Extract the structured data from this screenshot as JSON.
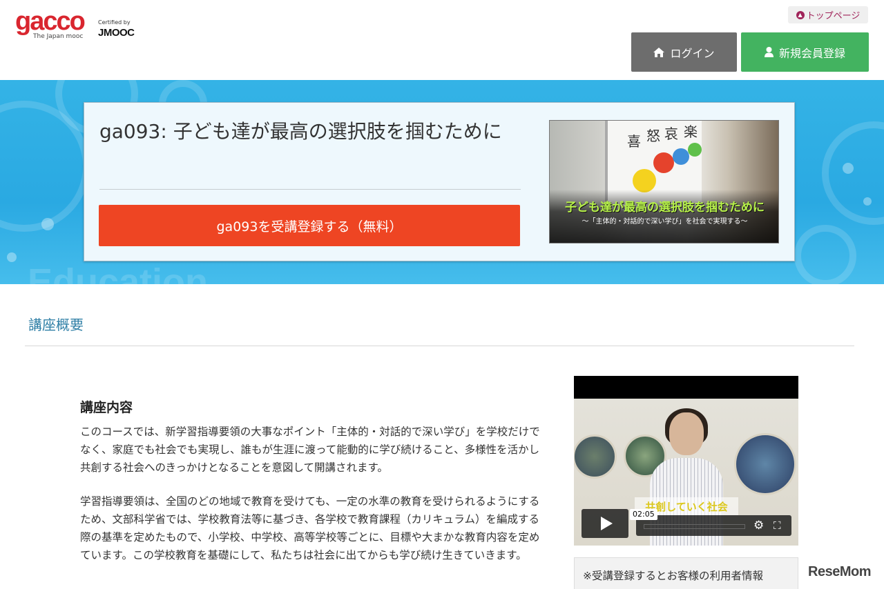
{
  "header": {
    "logo_text": "gacco",
    "logo_sub": "The Japan mooc",
    "certified_label": "Certified by",
    "certified_brand": "JMOOC",
    "toppage_label": "トップページ",
    "toppage_icon": "chevron-up-circle-icon",
    "login_label": "ログイン",
    "login_icon": "home-icon",
    "register_label": "新規会員登録",
    "register_icon": "user-icon",
    "colors": {
      "brand": "#d9262f",
      "login_bg": "#6d6d6d",
      "register_bg": "#43b360"
    }
  },
  "banner": {
    "course_title": "ga093: 子ども達が最高の選択肢を掴むために",
    "enroll_label": "ga093を受講登録する（無料）",
    "enroll_color": "#ee4523",
    "thumbnail": {
      "kanji": [
        "喜",
        "怒",
        "哀",
        "楽"
      ],
      "caption": "子ども達が最高の選択肢を掴むために",
      "subcaption": "～「主体的・対話的で深い学び」を社会で実現する～"
    }
  },
  "section": {
    "title": "講座概要"
  },
  "content": {
    "heading": "講座内容",
    "paragraph1": "このコースでは、新学習指導要領の大事なポイント「主体的・対話的で深い学び」を学校だけでなく、家庭でも社会でも実現し、誰もが生涯に渡って能動的に学び続けること、多様性を活かし共創する社会へのきっかけとなることを意図して開講されます。",
    "paragraph2": "学習指導要領は、全国のどの地域で教育を受けても、一定の水準の教育を受けられるようにするため、文部科学省では、学校教育法等に基づき、各学校で教育課程（カリキュラム）を編成する際の基準を定めたもので、小学校、中学校、高等学校等ごとに、目標や大まかな教育内容を定めています。この学校教育を基礎にして、私たちは社会に出てからも学び続け生きていきます。"
  },
  "video": {
    "banner_text": "共創していく社会",
    "time": "02:05",
    "progress": 0
  },
  "note": {
    "text": "※受講登録するとお客様の利用者情報"
  },
  "watermark": "ReseMom"
}
